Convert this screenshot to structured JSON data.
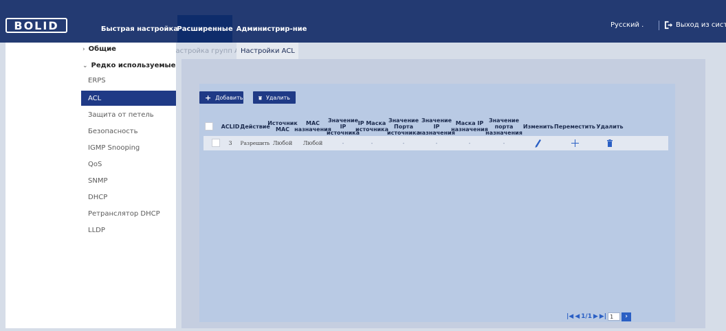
{
  "header": {
    "logo_text": "BOLID",
    "nav": [
      "Быстрая настройка",
      "Расширенные",
      "Администрир-ние"
    ],
    "active_nav": "Расширенные",
    "language": "Русский .",
    "logout": "Выход из систем"
  },
  "sidebar": {
    "groups": [
      {
        "label": "Общие",
        "caret": "›"
      },
      {
        "label": "Редко используемые",
        "caret": "⌄"
      }
    ],
    "items": [
      "ERPS",
      "ACL",
      "Защита от петель",
      "Безопасность",
      "IGMP Snooping",
      "QoS",
      "SNMP",
      "DHCP",
      "Ретранслятор DHCP",
      "LLDP"
    ],
    "active_item": "ACL"
  },
  "tabs": [
    "Настройка групп ACL",
    "Настройки ACL"
  ],
  "toolbar": {
    "add_label": "Добавить",
    "delete_label": "Удалить"
  },
  "table": {
    "headers": [
      "ACLID",
      "Действие",
      "Источник MAC",
      "MAC назначения",
      "Значение IP источника",
      "IP Маска источника",
      "Значение Порта источника",
      "Значение IP назначения",
      "Маска IP назначения",
      "Значение порта назначения",
      "Изменить",
      "Переместить",
      "Удалить"
    ],
    "rows": [
      {
        "aclid": "3",
        "action": "Разрешить",
        "src_mac": "Любой",
        "dst_mac": "Любой",
        "src_ip": "-",
        "src_mask": "-",
        "src_port": "-",
        "dst_ip": "-",
        "dst_mask": "-",
        "dst_port": "-",
        "edit_icon": "pencil-icon",
        "move_icon": "move-icon",
        "delete_icon": "trash-icon"
      }
    ]
  },
  "pager": {
    "text": "1/1",
    "page_input": "1",
    "go_icon": "chevron-right-icon"
  },
  "colors": {
    "header_bg": "#233a72",
    "active_nav_bg": "#0e2c6b",
    "accent": "#1f3a86",
    "panel": "#b9cae4",
    "icon_blue": "#2a5fc4"
  }
}
